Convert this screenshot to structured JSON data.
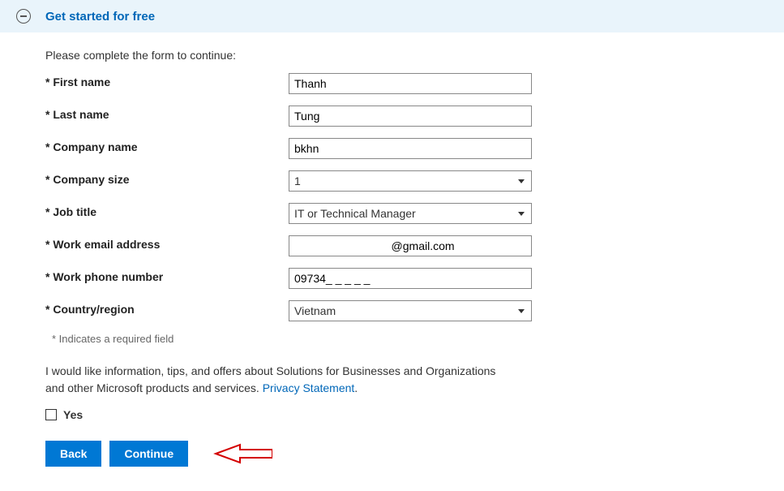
{
  "banner": {
    "title": "Get started for free"
  },
  "form": {
    "instruction": "Please complete the form to continue:",
    "fields": {
      "first_name": {
        "label": "* First name",
        "value": "Thanh"
      },
      "last_name": {
        "label": "* Last name",
        "value": "Tung"
      },
      "company_name": {
        "label": "* Company name",
        "value": "bkhn"
      },
      "company_size": {
        "label": "* Company size",
        "value": "1"
      },
      "job_title": {
        "label": "* Job title",
        "value": "IT or Technical Manager"
      },
      "work_email": {
        "label": "* Work email address",
        "value": "        @gmail.com"
      },
      "work_phone": {
        "label": "* Work phone number",
        "value": "09734_ _ _ _ _"
      },
      "country": {
        "label": "* Country/region",
        "value": "Vietnam"
      }
    },
    "required_note": "* Indicates a required field",
    "consent": "I would like information, tips, and offers about Solutions for Businesses and Organizations and other Microsoft products and services. ",
    "privacy_link": "Privacy Statement",
    "period": ".",
    "checkbox_label": "Yes"
  },
  "buttons": {
    "back": "Back",
    "continue": "Continue"
  }
}
